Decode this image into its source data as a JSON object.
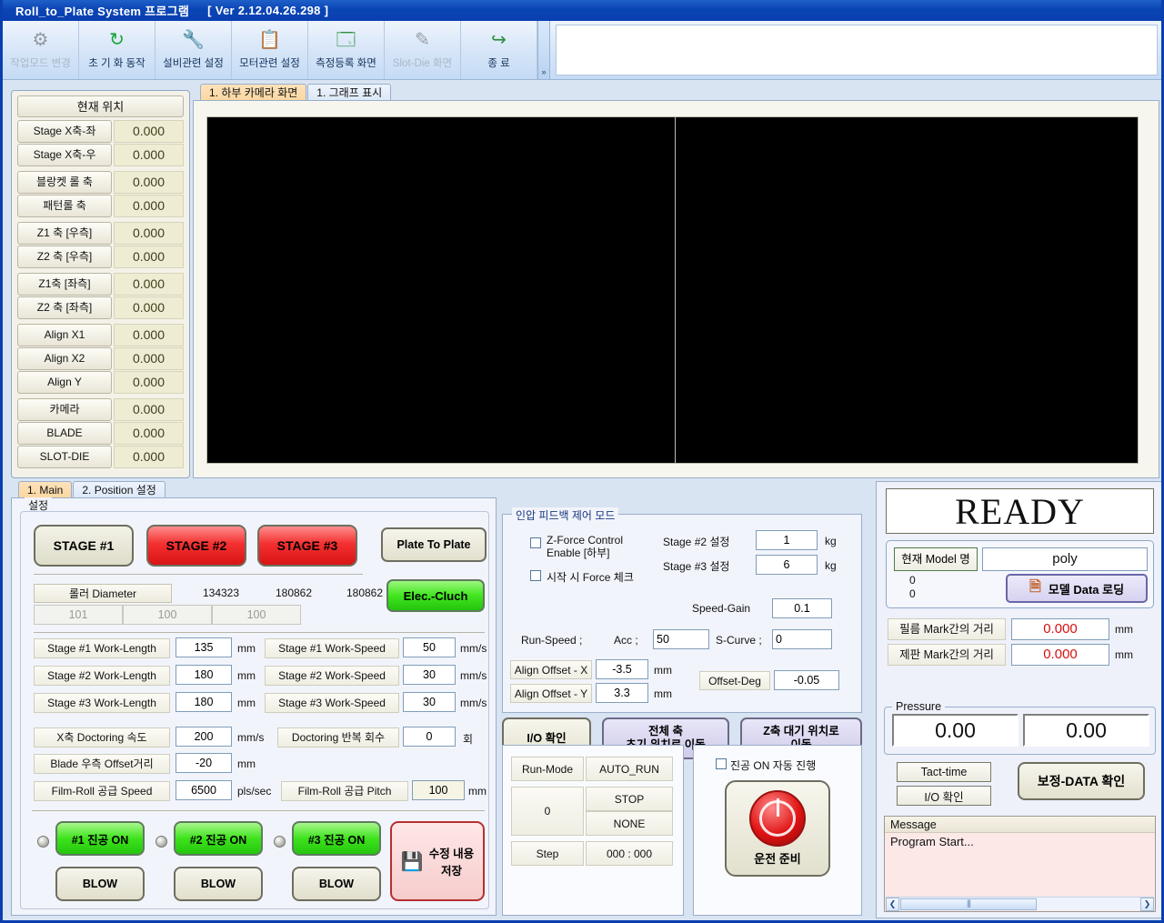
{
  "window": {
    "title": "Roll_to_Plate System 프로그램",
    "version": "[ Ver 2.12.04.26.298 ]",
    "accent": "#0a3fb0"
  },
  "toolbar": {
    "items": [
      {
        "label": "작업모드 변경",
        "icon": "mode-change-icon",
        "glyph": "⚙",
        "disabled": true
      },
      {
        "label": "초 기 화 동작",
        "icon": "initialize-icon",
        "glyph": "↻",
        "disabled": false
      },
      {
        "label": "설비관련 설정",
        "icon": "equipment-settings-icon",
        "glyph": "🔧",
        "disabled": false
      },
      {
        "label": "모터관련 설정",
        "icon": "motor-settings-icon",
        "glyph": "📋",
        "disabled": false
      },
      {
        "label": "측정등록 화면",
        "icon": "measure-register-icon",
        "glyph": "🗔",
        "disabled": false
      },
      {
        "label": "Slot-Die 화면",
        "icon": "slot-die-icon",
        "glyph": "✒",
        "disabled": true
      },
      {
        "label": "종      료",
        "icon": "exit-icon",
        "glyph": "↪",
        "disabled": false
      }
    ],
    "overflow": "»"
  },
  "position_panel": {
    "header": "현재 위치",
    "rows": [
      {
        "name": "Stage X축-좌",
        "value": "0.000",
        "gap": false
      },
      {
        "name": "Stage X축-우",
        "value": "0.000",
        "gap": false
      },
      {
        "name": "블랑켓 롤 축",
        "value": "0.000",
        "gap": true
      },
      {
        "name": "패턴롤 축",
        "value": "0.000",
        "gap": false
      },
      {
        "name": "Z1 축 [우측]",
        "value": "0.000",
        "gap": true
      },
      {
        "name": "Z2 축 [우측]",
        "value": "0.000",
        "gap": false
      },
      {
        "name": "Z1축 [좌측]",
        "value": "0.000",
        "gap": true
      },
      {
        "name": "Z2 축 [좌측]",
        "value": "0.000",
        "gap": false
      },
      {
        "name": "Align X1",
        "value": "0.000",
        "gap": true
      },
      {
        "name": "Align X2",
        "value": "0.000",
        "gap": false
      },
      {
        "name": "Align Y",
        "value": "0.000",
        "gap": false
      },
      {
        "name": "카메라",
        "value": "0.000",
        "gap": true
      },
      {
        "name": "BLADE",
        "value": "0.000",
        "gap": false
      },
      {
        "name": "SLOT-DIE",
        "value": "0.000",
        "gap": false
      }
    ]
  },
  "camera_tabs": {
    "tab1": "1. 하부 카메라 화면",
    "tab2": "1. 그래프 표시"
  },
  "settings_tabs": {
    "tab1": "1. Main",
    "tab2": "2. Position 설정"
  },
  "settings": {
    "group_label": "설정",
    "stage1": "STAGE #1",
    "stage2": "STAGE #2",
    "stage3": "STAGE #3",
    "plate_to_plate": "Plate To Plate",
    "elec_cluch": "Elec.-Cluch",
    "roller_diameter_label": "롤러 Diameter",
    "roller_counts": [
      "134323",
      "180862",
      "180862"
    ],
    "roller_values": [
      "101",
      "100",
      "100"
    ],
    "work_length_rows": [
      {
        "label": "Stage #1 Work-Length",
        "value": "135",
        "unit": "mm"
      },
      {
        "label": "Stage #2 Work-Length",
        "value": "180",
        "unit": "mm"
      },
      {
        "label": "Stage #3 Work-Length",
        "value": "180",
        "unit": "mm"
      }
    ],
    "work_speed_rows": [
      {
        "label": "Stage #1 Work-Speed",
        "value": "50",
        "unit": "mm/s"
      },
      {
        "label": "Stage #2 Work-Speed",
        "value": "30",
        "unit": "mm/s"
      },
      {
        "label": "Stage #3 Work-Speed",
        "value": "30",
        "unit": "mm/s"
      }
    ],
    "doctoring_speed_label": "X축 Doctoring 속도",
    "doctoring_speed_value": "200",
    "doctoring_speed_unit": "mm/s",
    "doctoring_repeat_label": "Doctoring 반복 회수",
    "doctoring_repeat_value": "0",
    "doctoring_repeat_unit": "회",
    "blade_offset_label": "Blade 우측 Offset거리",
    "blade_offset_value": "-20",
    "blade_offset_unit": "mm",
    "film_speed_label": "Film-Roll 공급 Speed",
    "film_speed_value": "6500",
    "film_speed_unit": "pls/sec",
    "film_pitch_label": "Film-Roll 공급 Pitch",
    "film_pitch_value": "100",
    "film_pitch_unit": "mm",
    "vacuum_buttons": [
      "#1 진공 ON",
      "#2 진공 ON",
      "#3 진공 ON"
    ],
    "blow_buttons": [
      "BLOW",
      "BLOW",
      "BLOW"
    ],
    "save_label": "수정 내용\n저장",
    "save_line1": "수정 내용",
    "save_line2": "저장"
  },
  "feedback": {
    "title": "인압 피드백 제어 모드",
    "zforce_line1": "Z-Force Control",
    "zforce_line2": "Enable [하부]",
    "zforce_checked": false,
    "force_check_label": "시작 시 Force 체크",
    "force_check_checked": false,
    "stage2_label": "Stage #2 설정",
    "stage2_value": "1",
    "stage2_unit": "kg",
    "stage3_label": "Stage #3 설정",
    "stage3_value": "6",
    "stage3_unit": "kg",
    "speed_gain_label": "Speed-Gain",
    "speed_gain_value": "0.1",
    "run_speed_label": "Run-Speed ;",
    "acc_label": "Acc ;",
    "acc_value": "50",
    "scurve_label": "S-Curve ;",
    "scurve_value": "0",
    "align_offset_x_label": "Align Offset - X",
    "align_offset_x_value": "-3.5",
    "align_offset_x_unit": "mm",
    "align_offset_y_label": "Align Offset - Y",
    "align_offset_y_value": "3.3",
    "align_offset_y_unit": "mm",
    "offset_deg_label": "Offset-Deg",
    "offset_deg_value": "-0.05"
  },
  "actions": {
    "io_check": "I/O 확인",
    "all_axis_home_line1": "전체 축",
    "all_axis_home_line2": "초기 위치로 이동",
    "z_wait_line1": "Z축 대기 위치로",
    "z_wait_line2": "이동"
  },
  "runmode": {
    "label": "Run-Mode",
    "value": "AUTO_RUN",
    "counter": "0",
    "status1": "STOP",
    "status2": "NONE",
    "step_label": "Step",
    "step_value": "000 : 000"
  },
  "autorun": {
    "checkbox_label": "진공 ON 자동 진행",
    "checked": false,
    "ready_button": "운전 준비"
  },
  "status": {
    "ready": "READY",
    "model_label": "현재 Model 명",
    "model_value": "poly",
    "counter1": "0",
    "counter2": "0",
    "load_button": "모델 Data 로딩",
    "film_mark_label": "필름 Mark간의 거리",
    "film_mark_value": "0.000",
    "film_mark_unit": "mm",
    "plate_mark_label": "제판 Mark간의 거리",
    "plate_mark_value": "0.000",
    "plate_mark_unit": "mm",
    "pressure_group": "Pressure",
    "pressure1": "0.00",
    "pressure2": "0.00",
    "tact_time": "Tact-time",
    "io_check": "I/O 확인",
    "calib_data": "보정-DATA 확인",
    "message_header": "Message",
    "message_line": "Program Start...",
    "scroll_left": "❮",
    "scroll_right": "❯",
    "value_color": "#d81010"
  }
}
